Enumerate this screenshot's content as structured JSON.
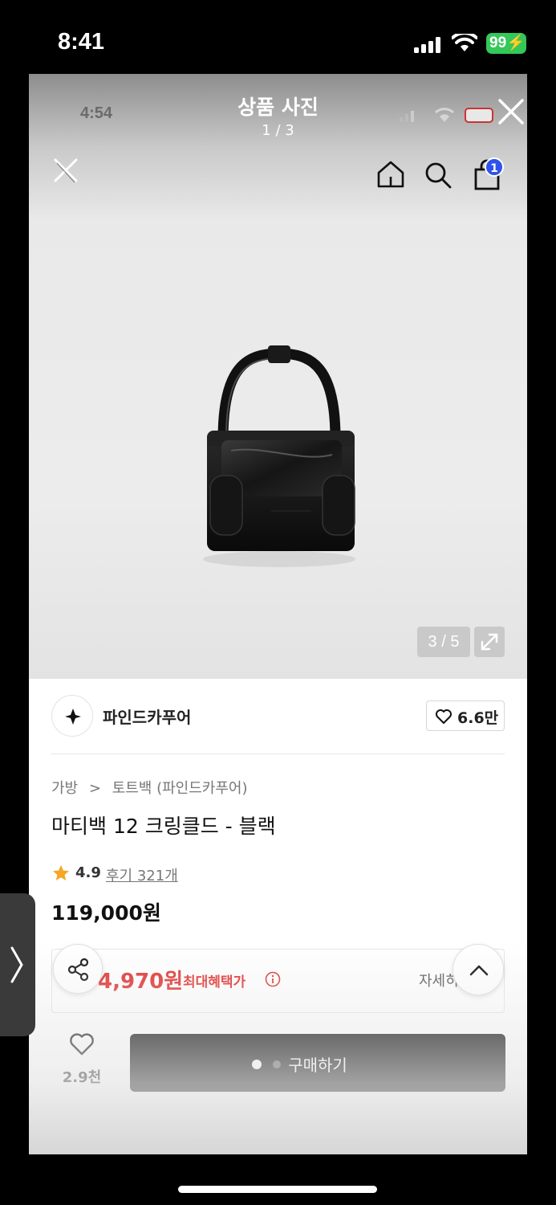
{
  "status_bar": {
    "time": "8:41",
    "battery": "99",
    "signal_icon": "cellular-signal-icon",
    "wifi_icon": "wifi-icon"
  },
  "viewer": {
    "title": "상품 사진",
    "count": "1 / 3",
    "ghost_time": "4:54",
    "close_icon": "close-icon"
  },
  "nav": {
    "close_icon": "close-icon",
    "home_icon": "home-icon",
    "search_icon": "search-icon",
    "bag_icon": "shopping-bag-icon",
    "cart_count": "1"
  },
  "gallery": {
    "image_counter": "3 / 5",
    "expand_icon": "expand-icon"
  },
  "brand": {
    "name": "파인드카푸어",
    "likes": "6.6만"
  },
  "product": {
    "breadcrumb": [
      "가방",
      "토트백 (파인드카푸어)"
    ],
    "breadcrumb_separator": ">",
    "title": "마티백 12 크링클드 - 블랙",
    "rating": "4.9",
    "reviews": "후기 321개",
    "price": "119,000원",
    "benefit_price": "4,970원",
    "benefit_label": "최대혜택가",
    "detail_link": "자세히"
  },
  "bottom_bar": {
    "wish_count": "2.9천",
    "buy_label": "구매하기"
  },
  "colors": {
    "accent_red": "#e0312f",
    "badge_blue": "#2f54eb",
    "battery_green": "#34c759"
  }
}
